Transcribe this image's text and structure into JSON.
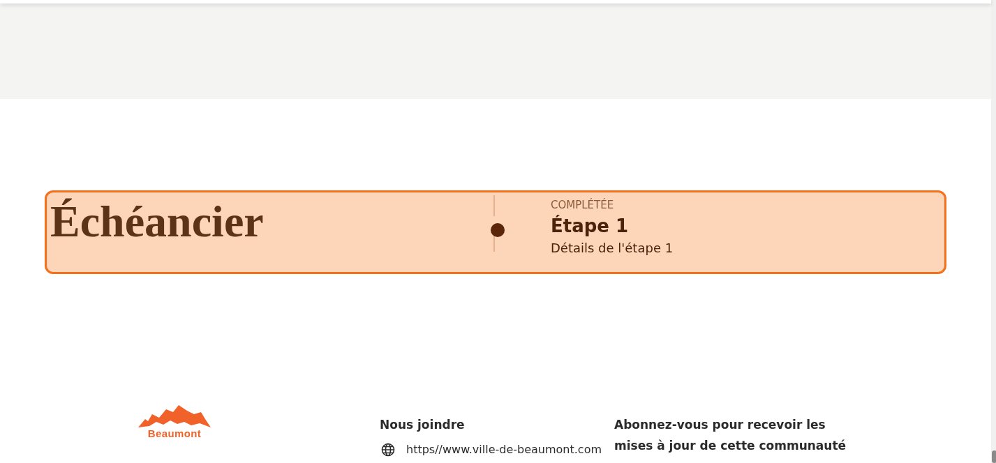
{
  "timeline": {
    "title": "Échéancier",
    "steps": [
      {
        "status": "COMPLÉTÉE",
        "title": "Étape 1",
        "details": "Détails de l'étape 1",
        "completed": true
      }
    ]
  },
  "footer": {
    "logo_text": "Beaumont",
    "contact_heading": "Nous joindre",
    "contacts": [
      {
        "kind": "website",
        "text": "https//www.ville-de-beaumont.com"
      }
    ],
    "subscribe_text": "Abonnez-vous pour recevoir les mises à jour de cette communauté"
  }
}
